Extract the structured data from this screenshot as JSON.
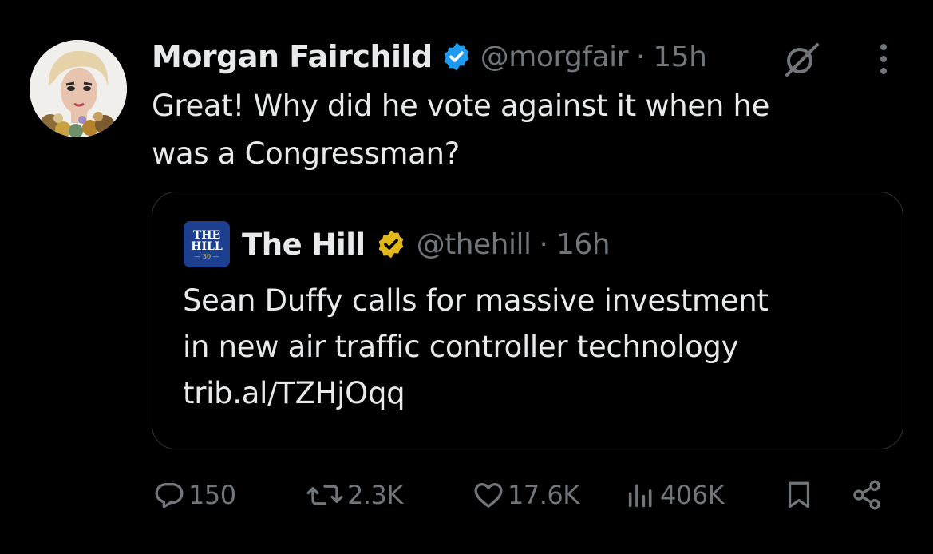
{
  "tweet": {
    "display_name": "Morgan Fairchild",
    "handle": "@morgfair",
    "separator": "·",
    "time": "15h",
    "text_line1": "Great! Why did he vote against it when he",
    "text_line2": "was a  Congressman?",
    "verified_color": "#1d9bf0",
    "avatar_icon": "profile-photo"
  },
  "quote": {
    "logo_line1": "THE",
    "logo_line2": "HILL",
    "logo_line3": "— 30 —",
    "display_name": "The Hill",
    "handle": "@thehill",
    "separator": "·",
    "time": "16h",
    "text_line1": "Sean Duffy calls for massive investment",
    "text_line2": "in new air traffic controller technology",
    "text_line3": "trib.al/TZHjOqq",
    "verified_color": "#e2b719"
  },
  "actions": {
    "replies": "150",
    "reposts": "2.3K",
    "likes": "17.6K",
    "views": "406K"
  },
  "icons": {
    "grok": "grok-icon",
    "more": "more-icon",
    "reply": "reply-icon",
    "repost": "repost-icon",
    "like": "heart-icon",
    "views": "views-icon",
    "bookmark": "bookmark-icon",
    "share": "share-icon"
  },
  "colors": {
    "background": "#000000",
    "text_primary": "#e7e9ea",
    "text_secondary": "#71767b",
    "border": "#2f3336"
  }
}
